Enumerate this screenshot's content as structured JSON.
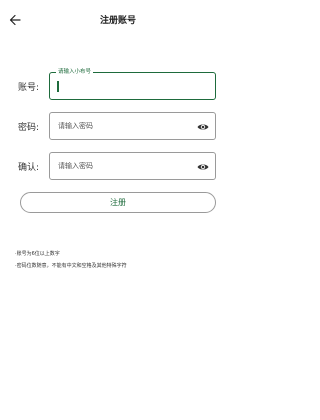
{
  "header": {
    "title": "注册账号",
    "back_icon": "arrow-left-icon"
  },
  "form": {
    "account": {
      "label": "账号:",
      "floating_label": "请输入小布号",
      "value": ""
    },
    "password": {
      "label": "密码:",
      "placeholder": "请输入密码",
      "icon": "eye-icon"
    },
    "confirm": {
      "label": "确认:",
      "placeholder": "请输入密码",
      "icon": "eye-icon"
    },
    "submit_label": "注册"
  },
  "hints": [
    "·账号为6位以上数字",
    "·密码位数随意，不能有中文和空格及其他特殊字符"
  ],
  "colors": {
    "accent": "#1e6b3c",
    "border": "#9a9a9a",
    "background": "#ffffff"
  }
}
